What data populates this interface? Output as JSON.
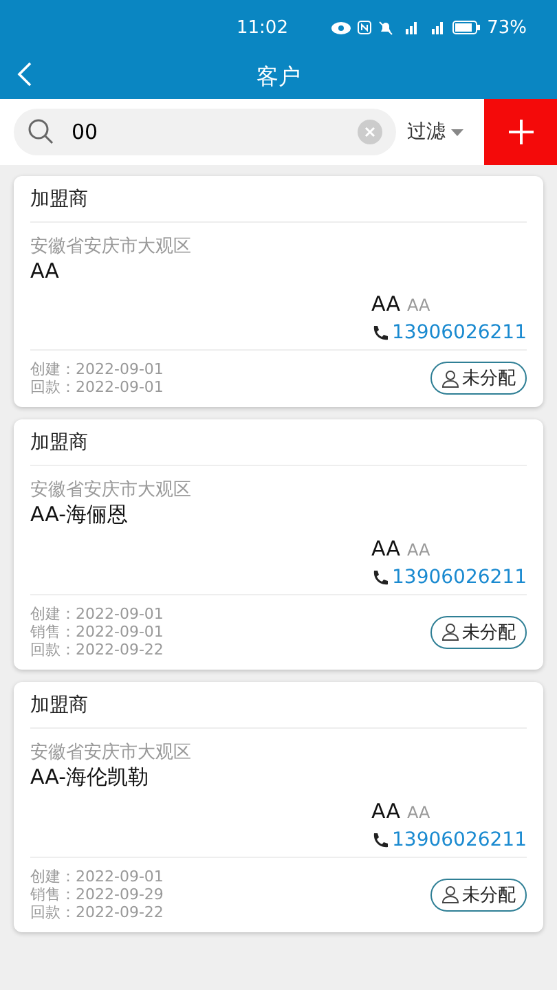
{
  "status_bar": {
    "time": "11:02",
    "battery": "73%"
  },
  "header": {
    "title": "客户"
  },
  "search": {
    "value": "00"
  },
  "filter": {
    "label": "过滤"
  },
  "customers": [
    {
      "type": "加盟商",
      "address": "安徽省安庆市大观区",
      "name": "AA",
      "contact": "AA",
      "contact_sub": "AA",
      "phone": "13906026211",
      "dates": [
        "创建：2022-09-01",
        "回款：2022-09-01"
      ],
      "status": "未分配"
    },
    {
      "type": "加盟商",
      "address": "安徽省安庆市大观区",
      "name": "AA-海俪恩",
      "contact": "AA",
      "contact_sub": "AA",
      "phone": "13906026211",
      "dates": [
        "创建：2022-09-01",
        "销售：2022-09-01",
        "回款：2022-09-22"
      ],
      "status": "未分配"
    },
    {
      "type": "加盟商",
      "address": "安徽省安庆市大观区",
      "name": "AA-海伦凯勒",
      "contact": "AA",
      "contact_sub": "AA",
      "phone": "13906026211",
      "dates": [
        "创建：2022-09-01",
        "销售：2022-09-29",
        "回款：2022-09-22"
      ],
      "status": "未分配"
    }
  ]
}
